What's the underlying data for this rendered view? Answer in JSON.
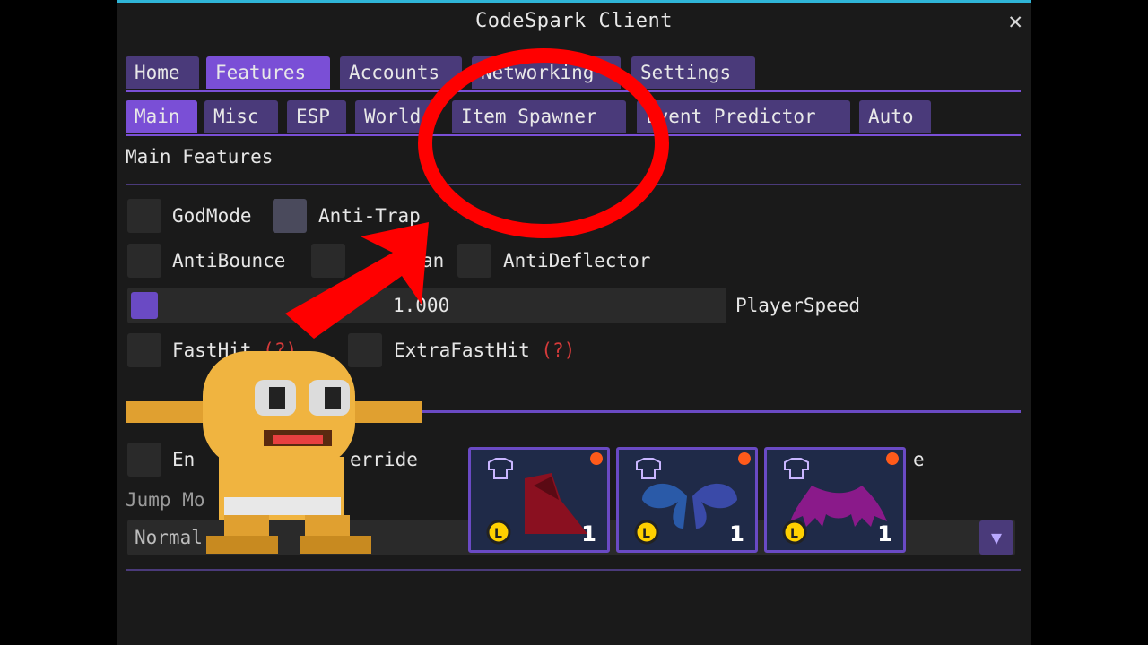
{
  "window": {
    "title": "CodeSpark Client",
    "close_label": "✕"
  },
  "main_tabs": [
    {
      "label": "Home"
    },
    {
      "label": "Features"
    },
    {
      "label": "Accounts"
    },
    {
      "label": "Networking"
    },
    {
      "label": "Settings"
    }
  ],
  "sub_tabs": [
    {
      "label": "Main"
    },
    {
      "label": "Misc"
    },
    {
      "label": "ESP"
    },
    {
      "label": "World"
    },
    {
      "label": "Item Spawner"
    },
    {
      "label": "Event Predictor"
    },
    {
      "label": "Auto"
    }
  ],
  "section": {
    "title": "Main Features"
  },
  "checkboxes": {
    "godmode": "GodMode",
    "anti_trap": "Anti-Trap",
    "anti_bounce": "AntiBounce",
    "anti_ban_partial": "an",
    "anti_deflector": "AntiDeflector",
    "fast_hit": "FastHit",
    "extra_fast_hit": "ExtraFastHit",
    "enable_partial": "En",
    "override_partial": "erride",
    "right_partial": "e",
    "help_marker": "(?)"
  },
  "player_speed": {
    "value": "1.000",
    "label": "PlayerSpeed"
  },
  "jump_mode": {
    "label": "Jump Mo",
    "value": "Normal",
    "arrow": "▼"
  },
  "items": [
    {
      "name": "cape-item",
      "count": "1"
    },
    {
      "name": "wings-item",
      "count": "1"
    },
    {
      "name": "bat-wings-item",
      "count": "1"
    }
  ],
  "colors": {
    "accent": "#7a4fd6",
    "tab": "#4a3a7a",
    "bg": "#1a1a1a",
    "highlight": "#ff0000"
  }
}
